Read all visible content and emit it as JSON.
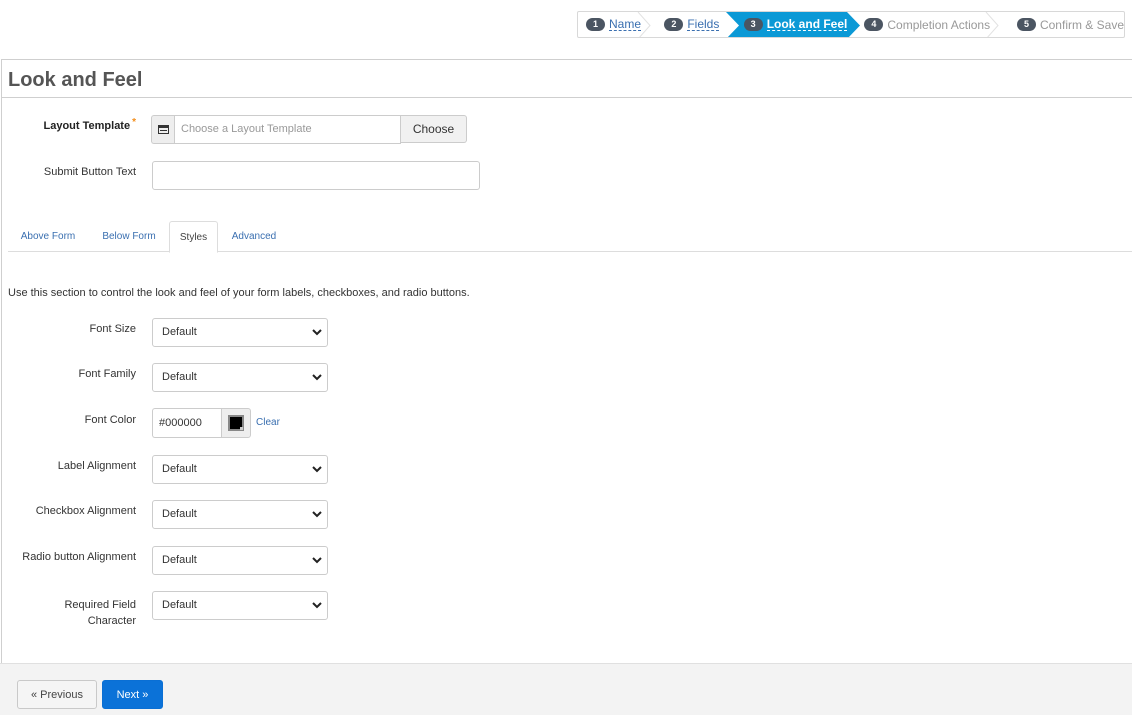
{
  "wizard": {
    "steps": [
      {
        "number": "1",
        "label": "Name",
        "state": "completed"
      },
      {
        "number": "2",
        "label": "Fields",
        "state": "completed"
      },
      {
        "number": "3",
        "label": "Look and Feel",
        "state": "active"
      },
      {
        "number": "4",
        "label": "Completion Actions",
        "state": "upcoming"
      },
      {
        "number": "5",
        "label": "Confirm & Save",
        "state": "upcoming"
      }
    ],
    "active_color": "#0b99d6"
  },
  "page": {
    "title": "Look and Feel"
  },
  "layout_template": {
    "label": "Layout Template",
    "required_marker": "*",
    "placeholder": "Choose a Layout Template",
    "value": "",
    "choose_label": "Choose",
    "icon": "template-icon"
  },
  "submit_button_text": {
    "label": "Submit Button Text",
    "value": ""
  },
  "tabs": [
    {
      "label": "Above Form",
      "active": false
    },
    {
      "label": "Below Form",
      "active": false
    },
    {
      "label": "Styles",
      "active": true
    },
    {
      "label": "Advanced",
      "active": false
    }
  ],
  "styles": {
    "intro": "Use this section to control the look and feel of your form labels, checkboxes, and radio buttons.",
    "font_size": {
      "label": "Font Size",
      "value": "Default"
    },
    "font_family": {
      "label": "Font Family",
      "value": "Default"
    },
    "font_color": {
      "label": "Font Color",
      "value": "#000000",
      "swatch": "#000000",
      "clear_label": "Clear"
    },
    "label_alignment": {
      "label": "Label Alignment",
      "value": "Default"
    },
    "checkbox_alignment": {
      "label": "Checkbox Alignment",
      "value": "Default"
    },
    "radio_alignment": {
      "label": "Radio button Alignment",
      "value": "Default"
    },
    "required_char": {
      "label_line1": "Required Field",
      "label_line2": "Character",
      "value": "Default"
    }
  },
  "footer": {
    "previous_label": "« Previous",
    "next_label": "Next »",
    "next_color": "#0b72d8"
  }
}
